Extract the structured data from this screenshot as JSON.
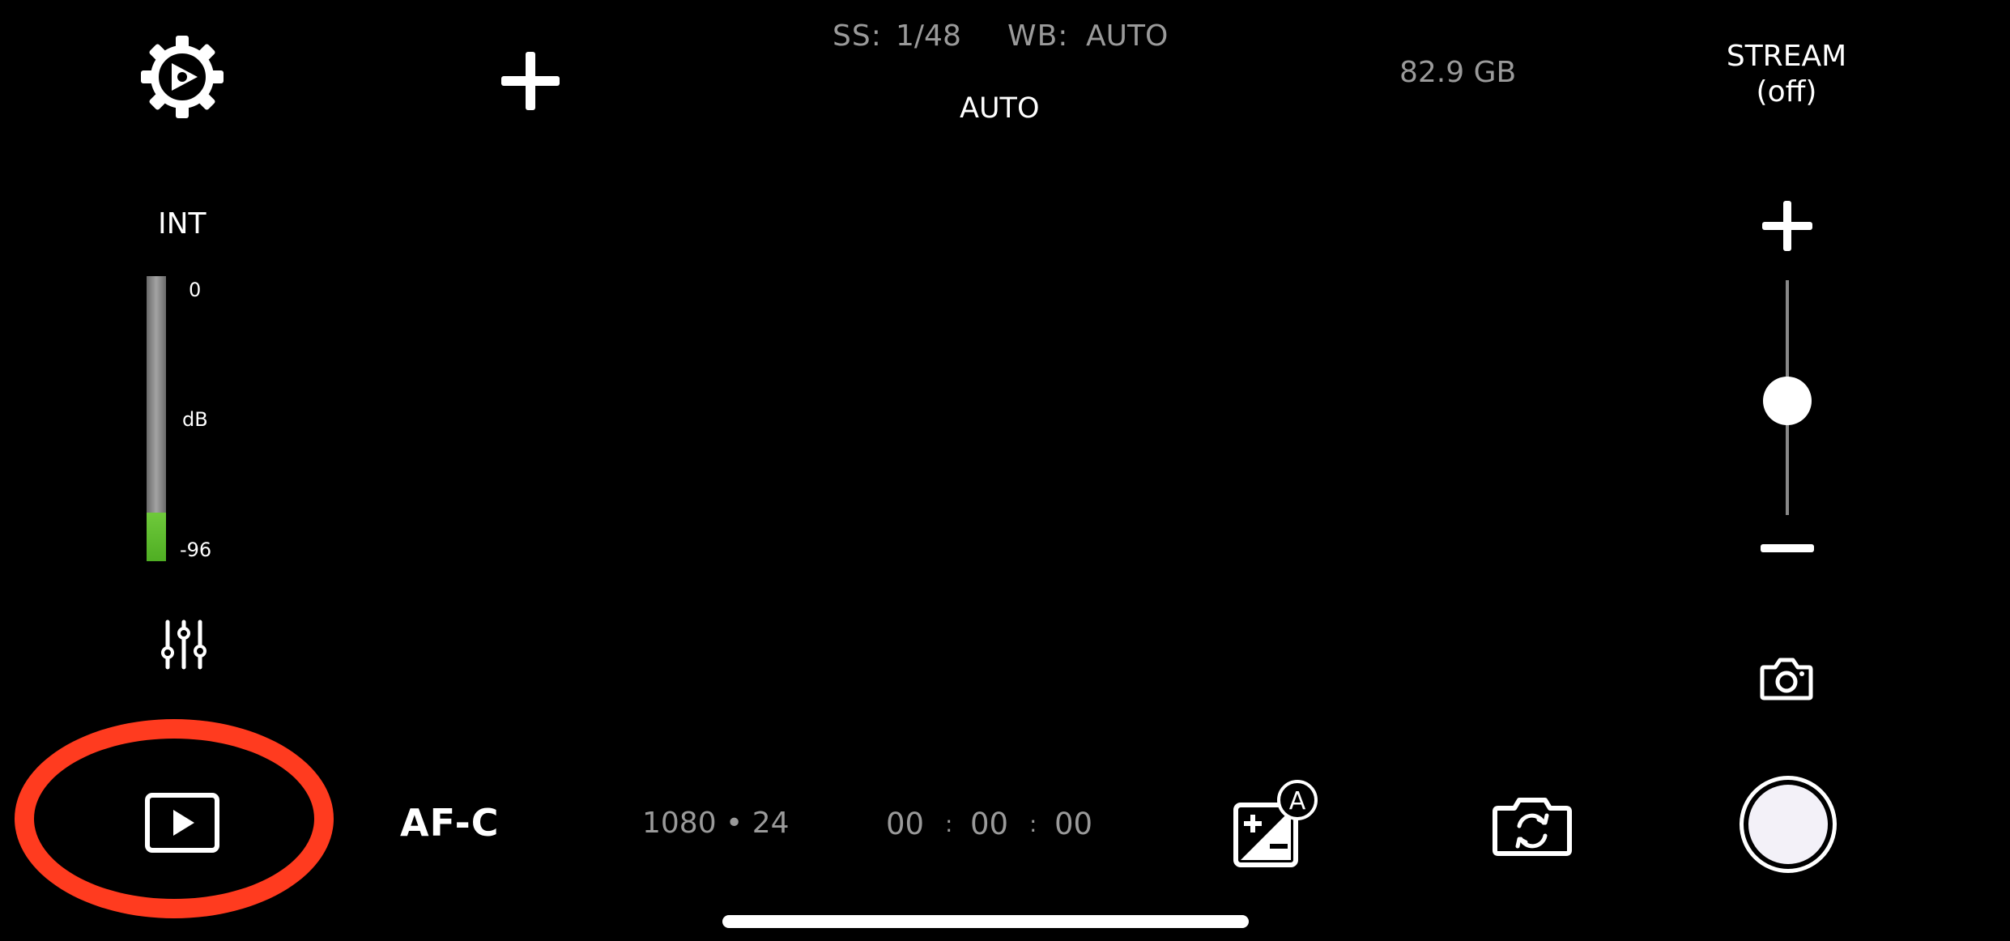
{
  "top_bar": {
    "settings_icon": "gear-play-icon",
    "add_icon": "plus-icon",
    "shutter_label": "SS:",
    "shutter_value": "1/48",
    "white_balance_label": "WB:",
    "white_balance_value": "AUTO",
    "mode_value": "AUTO",
    "storage": "82.9 GB",
    "stream_label": "STREAM",
    "stream_state": "(off)"
  },
  "audio": {
    "input_source": "INT",
    "meter_top": "0",
    "meter_unit": "dB",
    "meter_bottom": "-96",
    "meter_level": 0.17,
    "meter_color": "#5ebc2f",
    "settings_icon": "sliders-icon"
  },
  "zoom": {
    "plus_icon": "plus-icon",
    "minus_icon": "minus-icon",
    "level": 0.5,
    "photo_icon": "camera-icon"
  },
  "bottom_bar": {
    "play_icon": "playback-icon",
    "highlight_color": "#ff3b1f",
    "focus_mode": "AF-C",
    "format": "1080 • 24",
    "timecode": {
      "hours": "00",
      "minutes": "00",
      "seconds": "00",
      "separator": ":"
    },
    "exposure_icon": "exposure-auto-icon",
    "exposure_badge": "A",
    "flip_icon": "camera-flip-icon",
    "record_icon": "record-button"
  }
}
